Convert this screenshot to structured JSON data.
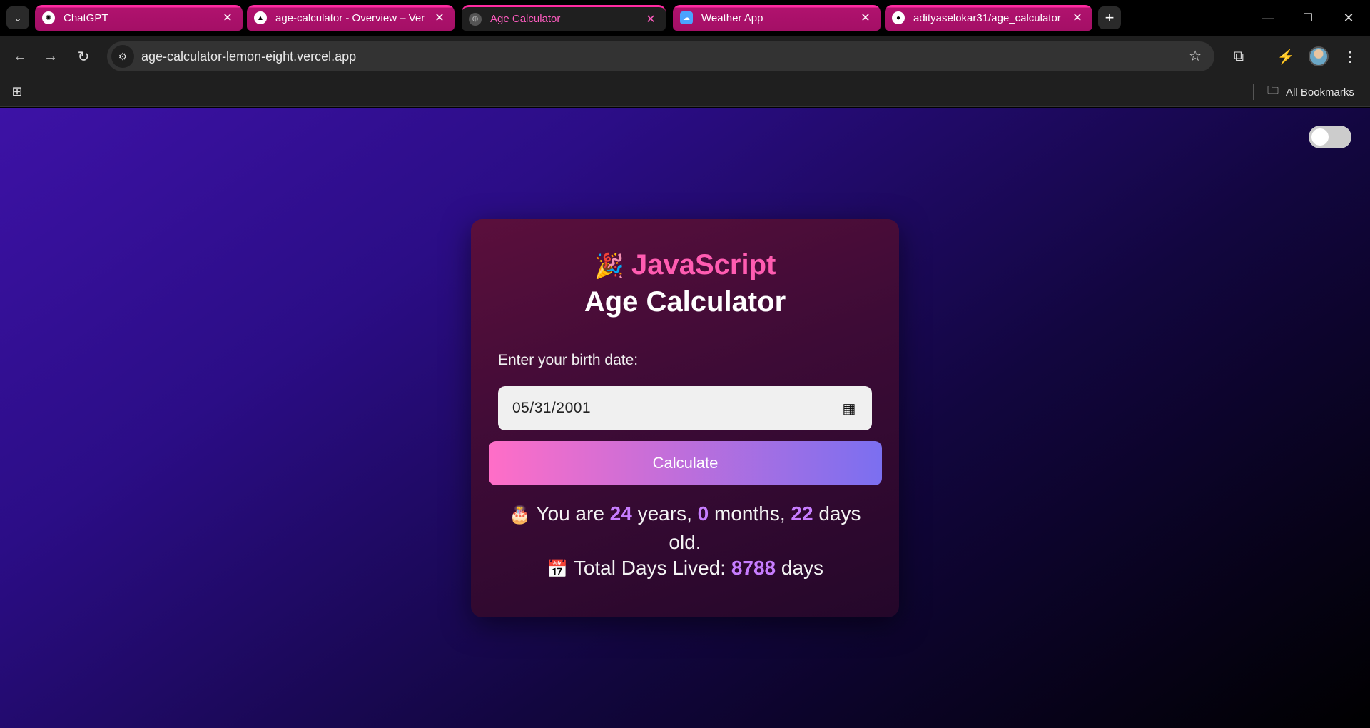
{
  "browser": {
    "tabs": [
      {
        "title": "ChatGPT",
        "icon": "chatgpt-icon",
        "active": false
      },
      {
        "title": "age-calculator - Overview – Ver",
        "icon": "vercel-icon",
        "active": false
      },
      {
        "title": "Age Calculator",
        "icon": "globe-icon",
        "active": true
      },
      {
        "title": "Weather App",
        "icon": "weather-icon",
        "active": false
      },
      {
        "title": "adityaselokar31/age_calculator",
        "icon": "github-icon",
        "active": false
      }
    ],
    "address": "age-calculator-lemon-eight.vercel.app",
    "bookmarks_label": "All Bookmarks",
    "accent_color": "#ff2aa1"
  },
  "app": {
    "heading_emoji": "🎉",
    "heading_line1": "JavaScript",
    "heading_line2": "Age Calculator",
    "birth_label": "Enter your birth date:",
    "birth_date": "05/31/2001",
    "calculate_label": "Calculate",
    "result": {
      "cake_emoji": "🎂",
      "prefix": "You are",
      "years": "24",
      "years_unit": "years,",
      "months": "0",
      "months_unit": "months,",
      "days": "22",
      "days_unit": "days old.",
      "calendar_emoji": "📅",
      "total_label": "Total Days Lived:",
      "total_days": "8788",
      "total_unit": "days"
    },
    "theme_toggle_on": false,
    "colors": {
      "heading_pink": "#ff5cb1",
      "highlight_purple": "#c77dff",
      "button_gradient_start": "#ff6ec7",
      "button_gradient_end": "#7b6ff0"
    }
  }
}
